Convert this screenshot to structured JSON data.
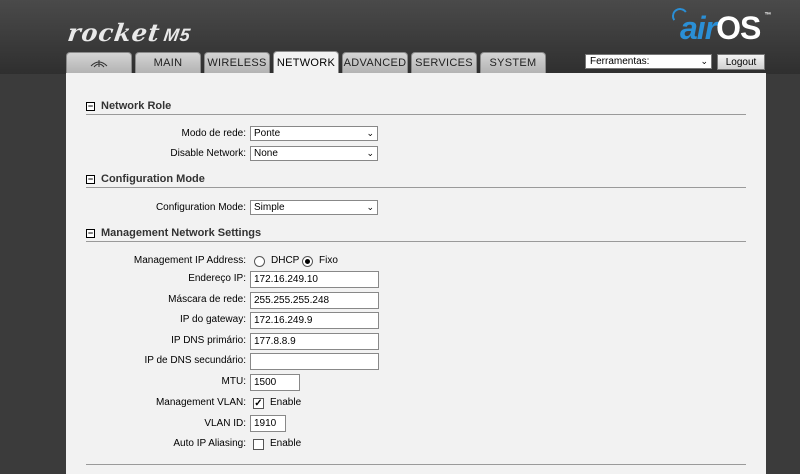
{
  "header": {
    "brand": "rocket",
    "model": "M5",
    "logo_air": "air",
    "logo_os": "OS",
    "logo_tm": "™"
  },
  "tabs": [
    {
      "label": ""
    },
    {
      "label": "MAIN"
    },
    {
      "label": "WIRELESS"
    },
    {
      "label": "NETWORK"
    },
    {
      "label": "ADVANCED"
    },
    {
      "label": "SERVICES"
    },
    {
      "label": "SYSTEM"
    }
  ],
  "toolbar": {
    "tools_value": "Ferramentas:",
    "logout_label": "Logout"
  },
  "network_role": {
    "title": "Network Role",
    "mode_label": "Modo de rede:",
    "mode_value": "Ponte",
    "disable_label": "Disable Network:",
    "disable_value": "None"
  },
  "config_mode": {
    "title": "Configuration Mode",
    "label": "Configuration Mode:",
    "value": "Simple"
  },
  "mgmt": {
    "title": "Management Network Settings",
    "ip_address_label": "Management IP Address:",
    "dhcp_label": "DHCP",
    "fixo_label": "Fixo",
    "ip_label": "Endereço IP:",
    "ip_value": "172.16.249.10",
    "mask_label": "Máscara de rede:",
    "mask_value": "255.255.255.248",
    "gateway_label": "IP do gateway:",
    "gateway_value": "172.16.249.9",
    "dns1_label": "IP DNS primário:",
    "dns1_value": "177.8.8.9",
    "dns2_label": "IP de DNS secundário:",
    "dns2_value": "",
    "mtu_label": "MTU:",
    "mtu_value": "1500",
    "vlan_label": "Management VLAN:",
    "vlan_enable_label": "Enable",
    "vlan_id_label": "VLAN ID:",
    "vlan_id_value": "1910",
    "alias_label": "Auto IP Aliasing:",
    "alias_enable_label": "Enable"
  },
  "colors": {
    "accent": "#2a8fd6",
    "background": "#3b3b3b",
    "panel": "#f2f2f2"
  }
}
